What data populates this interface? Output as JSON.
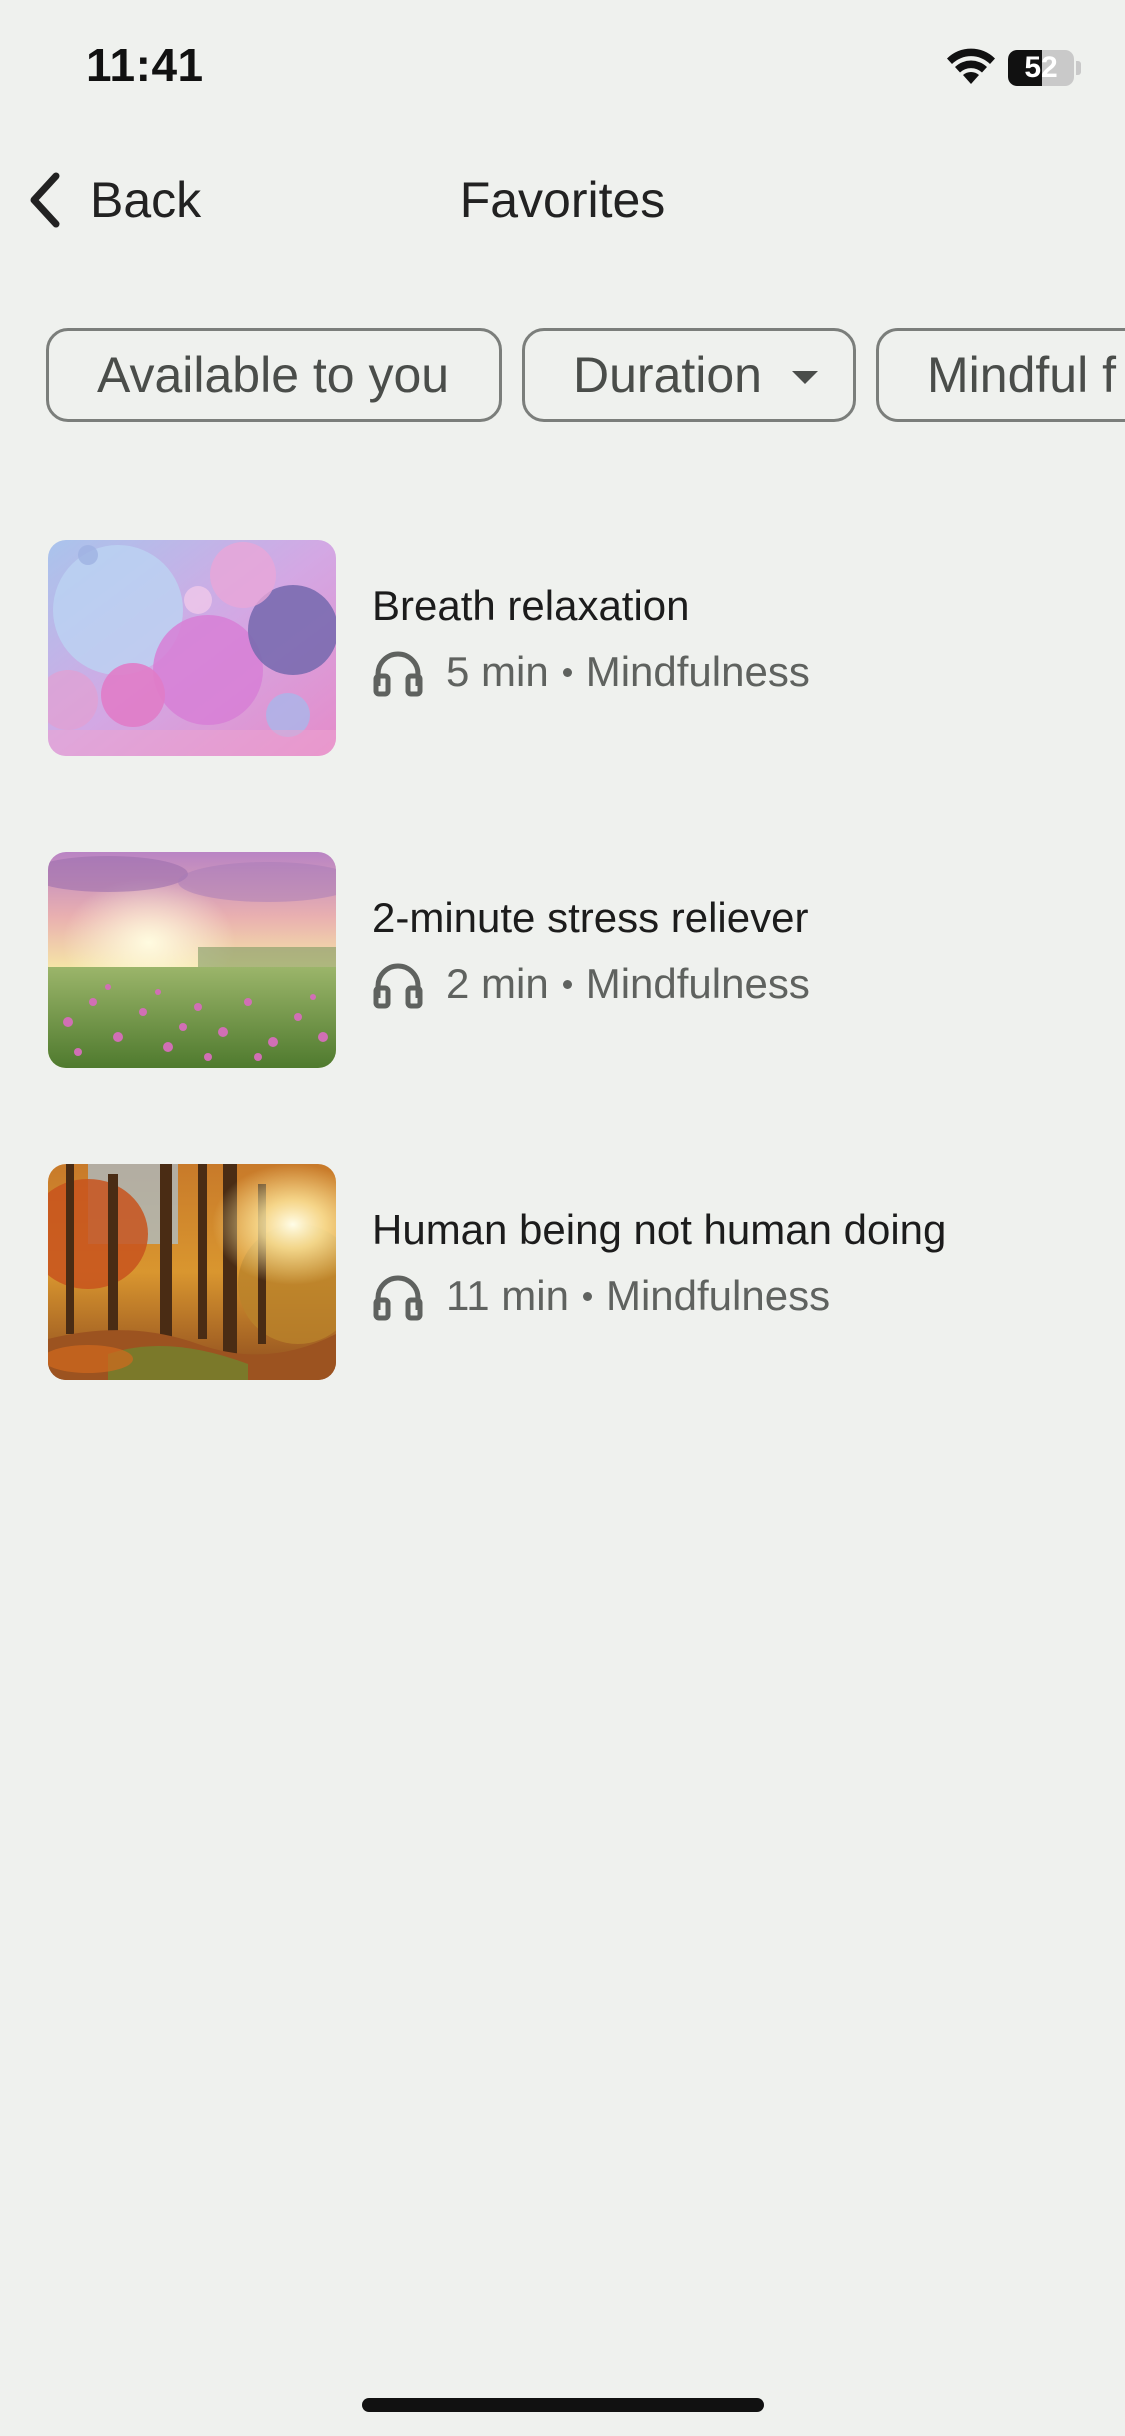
{
  "status_bar": {
    "time": "11:41",
    "battery_level": "52",
    "battery_fraction": 0.52
  },
  "header": {
    "back_label": "Back",
    "title": "Favorites"
  },
  "filters": [
    {
      "label": "Available to you",
      "has_dropdown": false
    },
    {
      "label": "Duration",
      "has_dropdown": true
    },
    {
      "label": "Mindful f",
      "has_dropdown": false
    }
  ],
  "items": [
    {
      "title": "Breath relaxation",
      "duration": "5 min",
      "category": "Mindfulness",
      "icon": "headphones-icon"
    },
    {
      "title": "2-minute stress reliever",
      "duration": "2 min",
      "category": "Mindfulness",
      "icon": "headphones-icon"
    },
    {
      "title": "Human being not human doing",
      "duration": "11 min",
      "category": "Mindfulness",
      "icon": "headphones-icon"
    }
  ],
  "colors": {
    "background": "#eff1ee",
    "chip_border": "#7b7e7b",
    "meta_text": "#5f625f"
  }
}
